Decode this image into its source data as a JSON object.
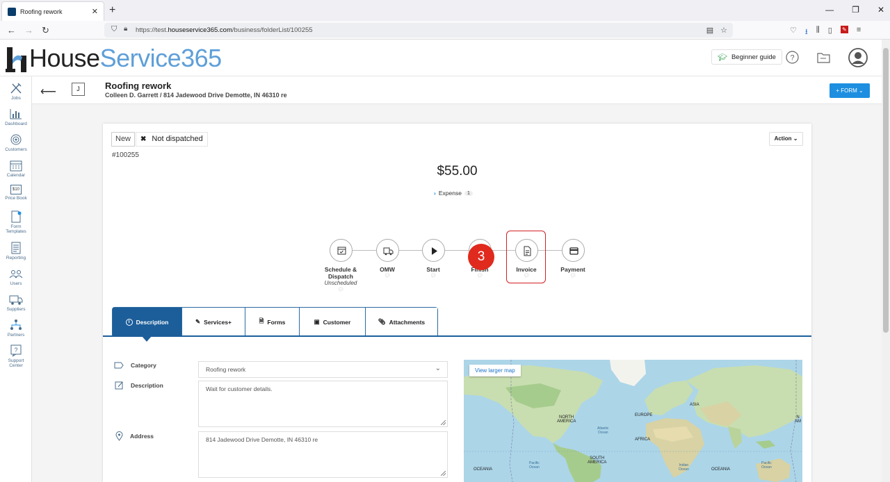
{
  "browser": {
    "tab_title": "Roofing rework",
    "url_prefix": "https://test.",
    "url_domain": "houseservice365.com",
    "url_path": "/business/folderList/100255"
  },
  "header": {
    "brand_part1": "House",
    "brand_part2": "Service365",
    "beginner_guide": "Beginner guide"
  },
  "sidebar": {
    "items": [
      {
        "label": "Jobs",
        "icon": "tools-icon"
      },
      {
        "label": "Dashboard",
        "icon": "chart-icon"
      },
      {
        "label": "Customers",
        "icon": "target-icon"
      },
      {
        "label": "Calendar",
        "icon": "calendar-icon"
      },
      {
        "label": "Price Book",
        "icon": "price-tag-icon"
      },
      {
        "label": "Form Templates",
        "icon": "form-icon"
      },
      {
        "label": "Reporting",
        "icon": "report-icon"
      },
      {
        "label": "Users",
        "icon": "users-icon"
      },
      {
        "label": "Suppliers",
        "icon": "truck-icon"
      },
      {
        "label": "Partners",
        "icon": "partners-icon"
      },
      {
        "label": "Support Center",
        "icon": "help-icon"
      }
    ],
    "price_badge": "$10"
  },
  "job": {
    "badge": "J",
    "title": "Roofing rework",
    "subtitle": "Colleen D. Garrett / 814 Jadewood Drive Demotte, IN 46310 re",
    "form_button": "+ FORM ⌄",
    "status_new": "New",
    "status_dispatch": "Not dispatched",
    "number": "#100255",
    "action_button": "Action",
    "amount": "$55.00",
    "expense_label": "Expense",
    "expense_count": "1"
  },
  "pipeline": {
    "steps": [
      {
        "label": "Schedule &",
        "label2": "Dispatch",
        "sub": "Unscheduled",
        "icon": "calendar-check-icon"
      },
      {
        "label": "OMW",
        "icon": "truck-icon"
      },
      {
        "label": "Start",
        "icon": "play-icon"
      },
      {
        "label": "Finish",
        "icon": "flag-icon"
      },
      {
        "label": "Invoice",
        "icon": "invoice-icon"
      },
      {
        "label": "Payment",
        "icon": "credit-card-icon"
      }
    ],
    "highlight_badge": "3"
  },
  "tabs": [
    {
      "label": "Description",
      "icon": "info-icon",
      "active": true
    },
    {
      "label": "Services+",
      "icon": "pencil-icon"
    },
    {
      "label": "Forms",
      "icon": "document-icon"
    },
    {
      "label": "Customer",
      "icon": "id-card-icon"
    },
    {
      "label": "Attachments",
      "icon": "paperclip-icon"
    }
  ],
  "form": {
    "category_label": "Category",
    "category_value": "Roofing rework",
    "description_label": "Description",
    "description_value": "Wait for customer details.",
    "address_label": "Address",
    "address_value": "814 Jadewood Drive Demotte, IN 46310 re"
  },
  "map": {
    "button": "View larger map",
    "labels": {
      "north_america": "NORTH\nAMERICA",
      "europe": "EUROPE",
      "asia": "ASIA",
      "africa": "AFRICA",
      "south_america": "SOUTH\nAMERICA",
      "oceania_left": "OCEANIA",
      "oceania_right": "OCEANIA",
      "atlantic": "Atlantic\nOcean",
      "pacific_left": "Pacific\nOcean",
      "pacific_right": "Pacific\nOcean",
      "indian": "Indian\nOcean",
      "north_america_right": "N\nAM"
    }
  }
}
